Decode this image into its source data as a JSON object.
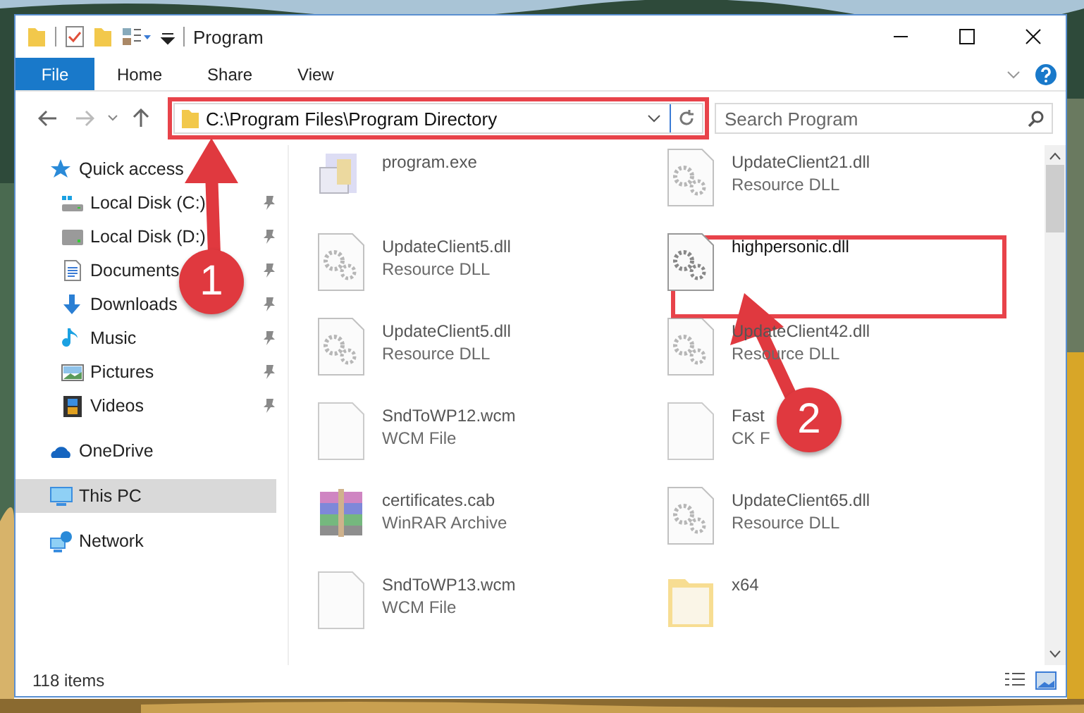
{
  "window": {
    "title": "Program"
  },
  "ribbon": {
    "tabs": [
      {
        "label": "File",
        "kind": "menu"
      },
      {
        "label": "Home",
        "kind": "tab"
      },
      {
        "label": "Share",
        "kind": "tab"
      },
      {
        "label": "View",
        "kind": "tab"
      }
    ]
  },
  "address_bar": {
    "path": "C:\\Program Files\\Program Directory"
  },
  "search": {
    "placeholder": "Search Program"
  },
  "navigation": [
    {
      "label": "Quick access",
      "selected": false,
      "children": [
        {
          "label": "Local Disk (C:)",
          "pinned": true,
          "selected": false
        },
        {
          "label": "Local Disk (D:)",
          "pinned": true,
          "selected": false
        },
        {
          "label": "Documents",
          "pinned": true,
          "selected": false
        },
        {
          "label": "Downloads",
          "pinned": true,
          "selected": false
        },
        {
          "label": "Music",
          "pinned": true,
          "selected": false
        },
        {
          "label": "Pictures",
          "pinned": true,
          "selected": false
        },
        {
          "label": "Videos",
          "pinned": true,
          "selected": false
        }
      ]
    },
    {
      "label": "OneDrive",
      "selected": false
    },
    {
      "label": "This PC",
      "selected": true
    },
    {
      "label": "Network",
      "selected": false
    }
  ],
  "files": [
    {
      "name": "program.exe",
      "kind": "exe",
      "blurred": true
    },
    {
      "name": "UpdateClient21.dll",
      "type": "Resource DLL",
      "kind": "dll",
      "blurred": true
    },
    {
      "name": "UpdateClient5.dll",
      "type": "Resource DLL",
      "kind": "dll",
      "blurred": true
    },
    {
      "name": "highpersonic.dll",
      "kind": "dll",
      "blurred": false
    },
    {
      "name": "UpdateClient5.dll",
      "type": "Resource DLL",
      "kind": "dll",
      "blurred": true
    },
    {
      "name": "UpdateClient42.dll",
      "type": "Resource DLL",
      "kind": "dll",
      "blurred": true
    },
    {
      "name": "SndToWP12.wcm",
      "type": "WCM File",
      "kind": "file",
      "blurred": true
    },
    {
      "name": "Fast",
      "type": "CK F",
      "kind": "file",
      "blurred": true
    },
    {
      "name": "certificates.cab",
      "type": "WinRAR Archive",
      "kind": "archive",
      "blurred": true
    },
    {
      "name": "UpdateClient65.dll",
      "type": "Resource DLL",
      "kind": "dll",
      "blurred": true
    },
    {
      "name": "SndToWP13.wcm",
      "type": "WCM File",
      "kind": "file",
      "blurred": true
    },
    {
      "name": "x64",
      "kind": "folder",
      "blurred": true
    }
  ],
  "status_bar": {
    "item_count": "118 items"
  },
  "annotations": [
    {
      "number": "1"
    },
    {
      "number": "2"
    }
  ]
}
